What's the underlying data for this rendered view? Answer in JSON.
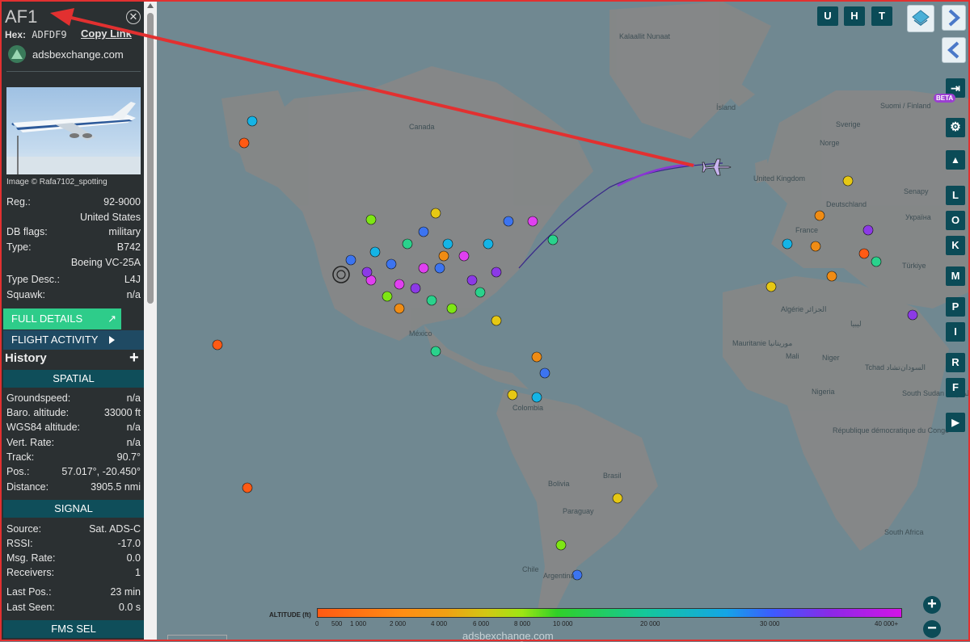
{
  "sidebar": {
    "callsign": "AF1",
    "hex_label": "Hex:",
    "hex_value": "ADFDF9",
    "copy_link": "Copy Link",
    "source_name": "adsbexchange.com",
    "photo_credit": "Image © Rafa7102_spotting",
    "aircraft_fields": [
      {
        "label": "Reg.:",
        "value": "92-9000"
      },
      {
        "label": "",
        "value": "United States"
      },
      {
        "label": "DB flags:",
        "value": "military"
      },
      {
        "label": "Type:",
        "value": "B742"
      },
      {
        "label": "",
        "value": "Boeing VC-25A"
      },
      {
        "label": "Type Desc.:",
        "value": "L4J"
      },
      {
        "label": "Squawk:",
        "value": "n/a"
      }
    ],
    "full_details": "FULL DETAILS",
    "flight_activity": "FLIGHT ACTIVITY",
    "history": "History",
    "spatial_header": "SPATIAL",
    "spatial_fields": [
      {
        "label": "Groundspeed:",
        "value": "n/a"
      },
      {
        "label": "Baro. altitude:",
        "value": "33000 ft"
      },
      {
        "label": "WGS84 altitude:",
        "value": "n/a"
      },
      {
        "label": "Vert. Rate:",
        "value": "n/a"
      },
      {
        "label": "Track:",
        "value": "90.7°"
      },
      {
        "label": "Pos.:",
        "value": "57.017°, -20.450°"
      },
      {
        "label": "Distance:",
        "value": "3905.5 nmi"
      }
    ],
    "signal_header": "SIGNAL",
    "signal_fields": [
      {
        "label": "Source:",
        "value": "Sat. ADS-C"
      },
      {
        "label": "RSSI:",
        "value": "-17.0"
      },
      {
        "label": "Msg. Rate:",
        "value": "0.0"
      },
      {
        "label": "Receivers:",
        "value": "1"
      },
      {
        "label": "Last Pos.:",
        "value": "23 min"
      },
      {
        "label": "Last Seen:",
        "value": "0.0 s"
      }
    ],
    "fms_header": "FMS SEL"
  },
  "map": {
    "top_buttons": [
      "U",
      "H",
      "T"
    ],
    "side_buttons": [
      "L",
      "O",
      "K",
      "M",
      "P",
      "I",
      "R",
      "F"
    ],
    "beta": "BETA",
    "zoom_in": "+",
    "zoom_out": "−",
    "labels": [
      "Kalaallit Nunaat",
      "Canada",
      "Ísland",
      "Suomi / Finland",
      "Sverige",
      "Norge",
      "United Kingdom",
      "Deutschland",
      "France",
      "Україна",
      "Türkiye",
      "Algérie الجزائر",
      "ليبيا",
      "México",
      "Colombia",
      "Brasil",
      "Bolivia",
      "Paraguay",
      "Argentina",
      "Chile",
      "Mali",
      "Niger",
      "Tchad تشاد",
      "Nigeria",
      "Mauritanie موريتانيا",
      "République démocratique du Congo",
      "السودان",
      "South Sudan جنوب السودان",
      "South Africa",
      "Senapy"
    ],
    "legend_title": "ALTITUDE (ft)",
    "legend_ticks": [
      "0",
      "500",
      "1 000",
      "2 000",
      "4 000",
      "6 000",
      "8 000",
      "10 000",
      "20 000",
      "30 000",
      "40 000+"
    ],
    "footer_brand": "adsbexchange.com"
  },
  "colors": {
    "annotation_arrow": "#e23030",
    "sidebar_bg": "#2b3032",
    "accent_green": "#2ecc8a",
    "section_teal": "#0f4e5a",
    "button_dark": "#0b4b57"
  }
}
